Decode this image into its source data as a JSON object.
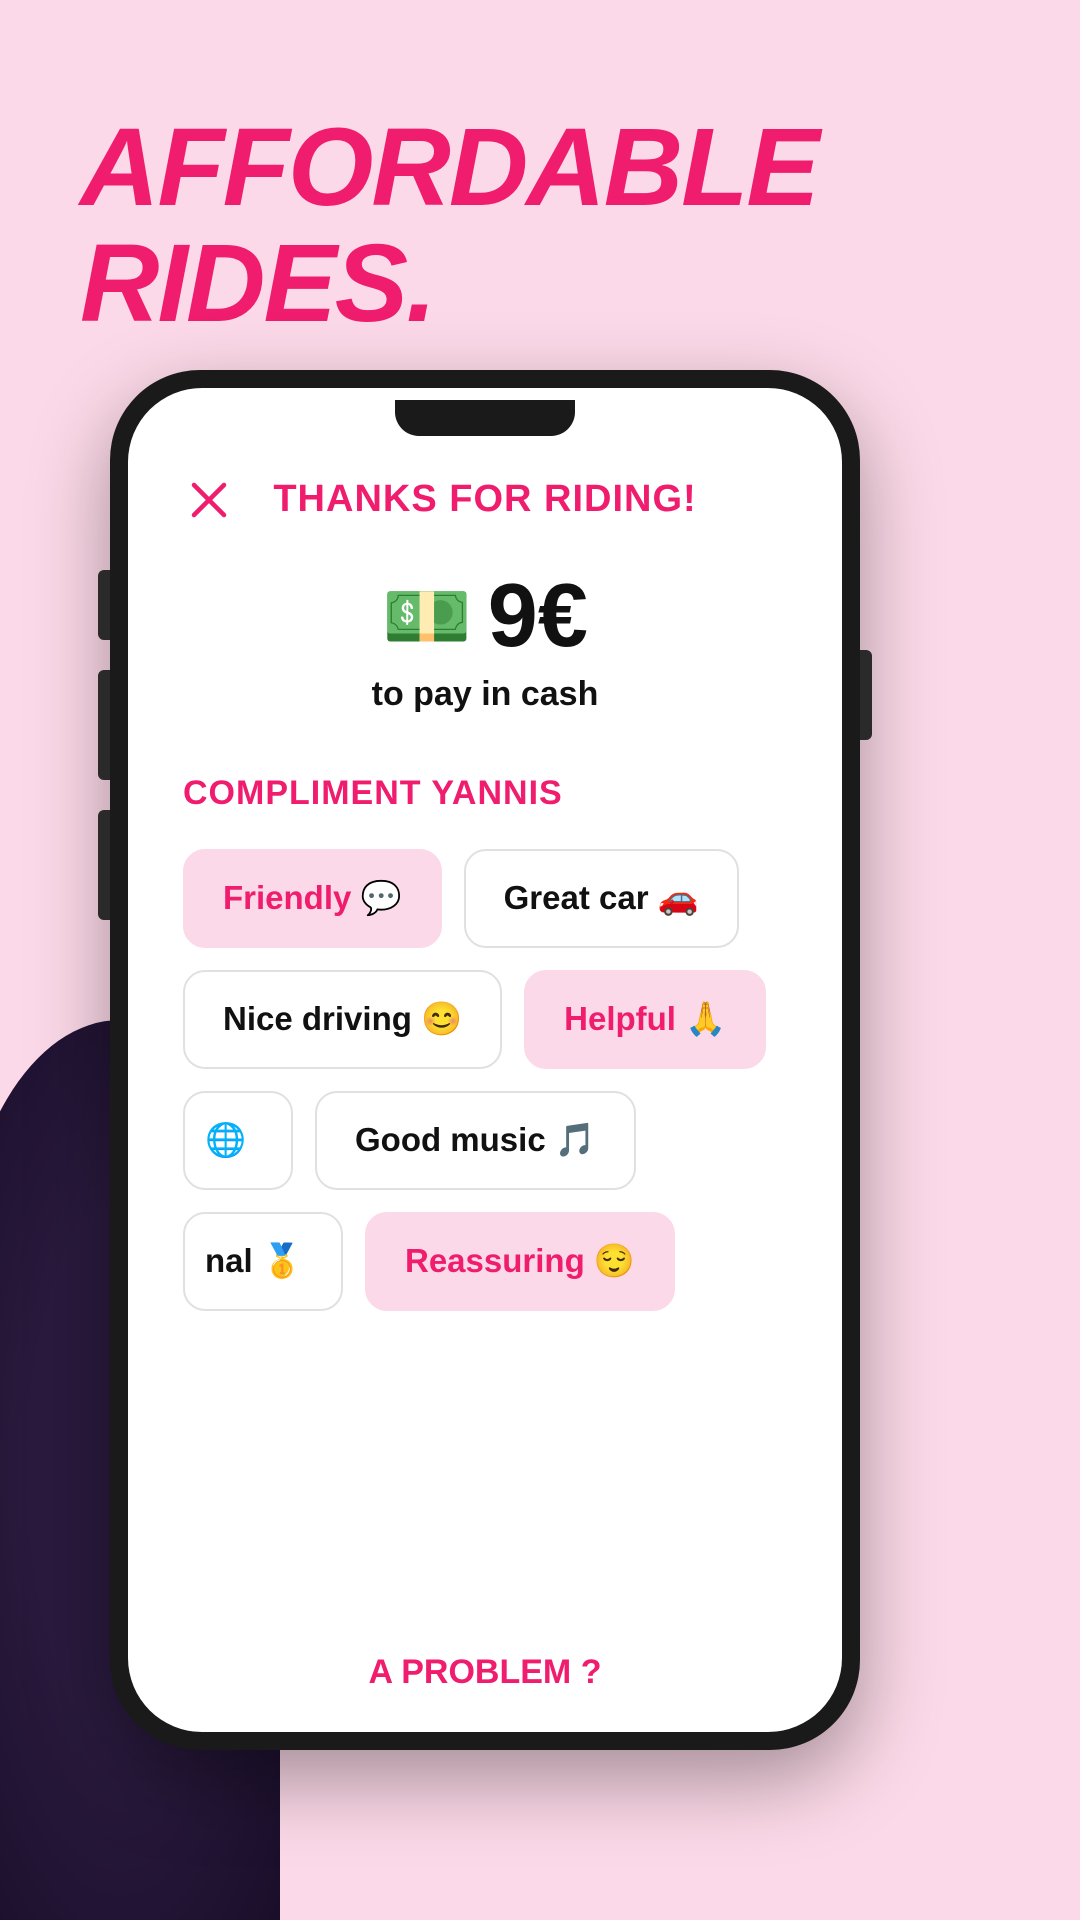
{
  "background": {
    "color": "#fcd9e8"
  },
  "headline": {
    "line1": "AFFORDABLE",
    "line2": "RIDES."
  },
  "phone": {
    "header": {
      "close_label": "×",
      "title": "THANKS FOR RIDING!"
    },
    "price": {
      "emoji": "💵",
      "amount": "9€",
      "subtitle": "to pay in cash"
    },
    "compliment": {
      "title": "COMPLIMENT YANNIS",
      "chips": [
        {
          "label": "Friendly 💬",
          "selected": true
        },
        {
          "label": "Great car 🚗",
          "selected": false
        },
        {
          "label": "Nice driving 😊",
          "selected": false
        },
        {
          "label": "Helpful 🙏",
          "selected": true
        },
        {
          "label": "🌐",
          "selected": false
        },
        {
          "label": "Good music 🎵",
          "selected": false
        },
        {
          "label": "nal 🥇",
          "selected": false
        },
        {
          "label": "Reassuring 😌",
          "selected": true
        }
      ]
    },
    "bottom_link": "A problem ?"
  }
}
